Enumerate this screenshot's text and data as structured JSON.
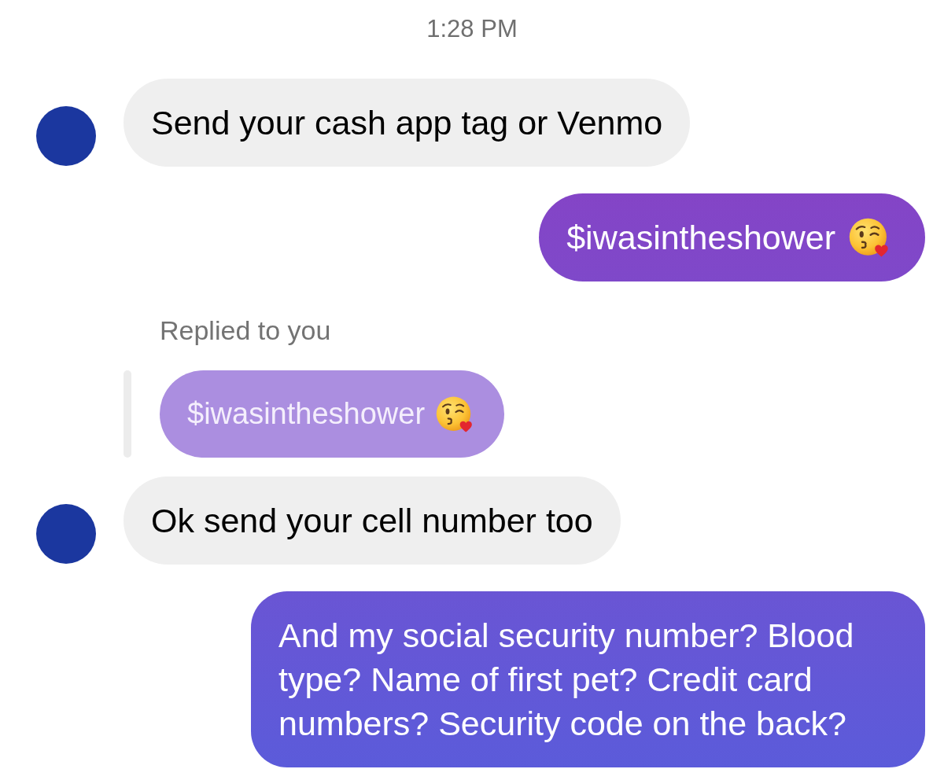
{
  "timestamp": "1:28 PM",
  "messages": [
    {
      "kind": "incoming",
      "text": "Send your cash app tag or Venmo",
      "emoji": false
    },
    {
      "kind": "outgoing",
      "text": "$iwasintheshower",
      "emoji": true
    },
    {
      "kind": "incoming",
      "reply": {
        "label": "Replied to you",
        "text": "$iwasintheshower",
        "emoji": true
      },
      "text": "Ok send your cell number too",
      "emoji": false
    },
    {
      "kind": "outgoing",
      "text": "And my social security number? Blood type? Name of first pet? Credit card numbers? Security code on the back?",
      "emoji": false
    }
  ]
}
